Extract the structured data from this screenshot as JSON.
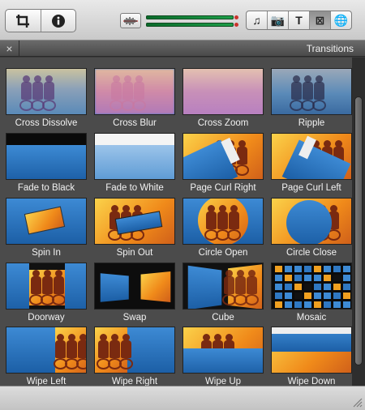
{
  "toolbar": {
    "left_tools": [
      {
        "name": "crop",
        "icon": "crop-icon"
      },
      {
        "name": "inspector",
        "icon": "info-icon"
      }
    ],
    "audio_icon": "audio-waveform-icon",
    "browsers": [
      {
        "name": "music",
        "icon": "music-note-icon",
        "glyph": "♫"
      },
      {
        "name": "photos",
        "icon": "camera-icon",
        "glyph": "📷"
      },
      {
        "name": "titles",
        "icon": "title-t-icon",
        "glyph": "T"
      },
      {
        "name": "transitions",
        "icon": "transitions-icon",
        "glyph": "⊠",
        "active": true
      },
      {
        "name": "maps",
        "icon": "globe-icon",
        "glyph": "🌐"
      }
    ]
  },
  "panel": {
    "title": "Transitions",
    "close_glyph": "×"
  },
  "transitions": [
    {
      "label": "Cross Dissolve",
      "style": "dissolve"
    },
    {
      "label": "Cross Blur",
      "style": "blur"
    },
    {
      "label": "Cross Zoom",
      "style": "zoom"
    },
    {
      "label": "Ripple",
      "style": "ripple"
    },
    {
      "label": "Fade to Black",
      "style": "fadeblack"
    },
    {
      "label": "Fade to White",
      "style": "fadewhite"
    },
    {
      "label": "Page Curl Right",
      "style": "curlright"
    },
    {
      "label": "Page Curl Left",
      "style": "curlleft"
    },
    {
      "label": "Spin In",
      "style": "spinin"
    },
    {
      "label": "Spin Out",
      "style": "spinout"
    },
    {
      "label": "Circle Open",
      "style": "circleopen"
    },
    {
      "label": "Circle Close",
      "style": "circleclose"
    },
    {
      "label": "Doorway",
      "style": "doorway"
    },
    {
      "label": "Swap",
      "style": "swap"
    },
    {
      "label": "Cube",
      "style": "cube"
    },
    {
      "label": "Mosaic",
      "style": "mosaic"
    },
    {
      "label": "Wipe Left",
      "style": "wipeleft"
    },
    {
      "label": "Wipe Right",
      "style": "wiperight"
    },
    {
      "label": "Wipe Up",
      "style": "wipeup"
    },
    {
      "label": "Wipe Down",
      "style": "wipedown"
    }
  ],
  "colors": {
    "water_blue": "#2f78c2",
    "sunset_orange": "#f0a020",
    "panel_bg": "#4b4b4b",
    "meter_green": "#1ea04a"
  }
}
